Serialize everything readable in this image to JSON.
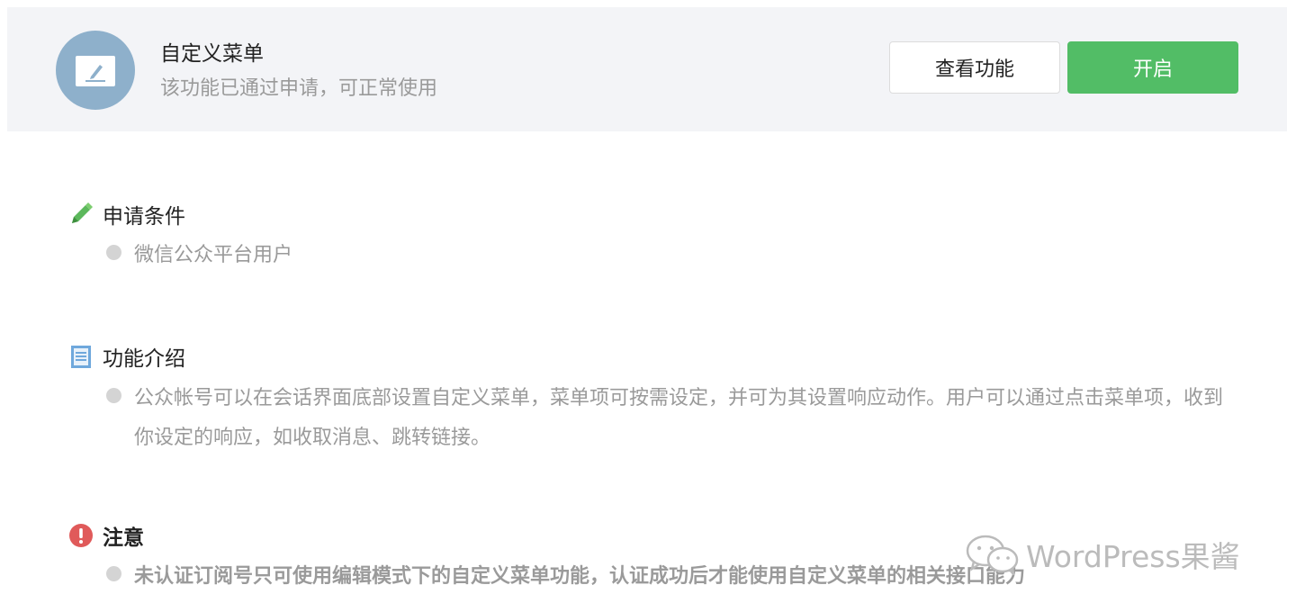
{
  "header": {
    "title": "自定义菜单",
    "subtitle": "该功能已通过申请，可正常使用",
    "view_button": "查看功能",
    "enable_button": "开启"
  },
  "sections": {
    "conditions": {
      "icon": "pencil-icon",
      "title": "申请条件",
      "items": [
        "微信公众平台用户"
      ]
    },
    "intro": {
      "icon": "document-icon",
      "title": "功能介绍",
      "items": [
        "公众帐号可以在会话界面底部设置自定义菜单，菜单项可按需设定，并可为其设置响应动作。用户可以通过点击菜单项，收到你设定的响应，如收取消息、跳转链接。"
      ]
    },
    "notice": {
      "icon": "exclamation-icon",
      "title": "注意",
      "items": [
        "未认证订阅号只可使用编辑模式下的自定义菜单功能，认证成功后才能使用自定义菜单的相关接口能力"
      ]
    }
  },
  "watermark": {
    "text": "WordPress果酱"
  },
  "colors": {
    "header_bg": "#f3f4f7",
    "primary_green": "#52bd66",
    "avatar_blue": "#8eb0cb",
    "alert_red": "#e05a5a",
    "muted_text": "#9a9a9a"
  }
}
